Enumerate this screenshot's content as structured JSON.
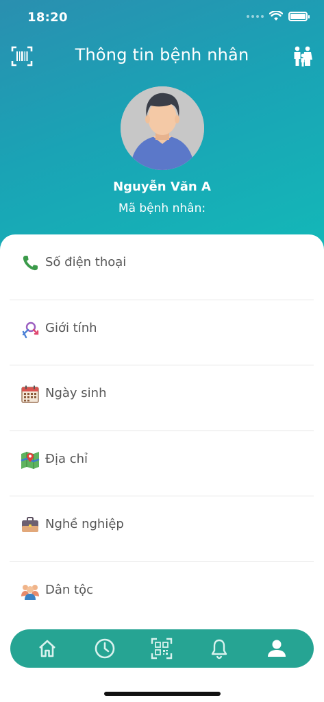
{
  "status_bar": {
    "time": "18:20"
  },
  "header": {
    "title": "Thông tin bệnh nhân",
    "left_icon": "barcode-scan-icon",
    "right_icon": "family-icon"
  },
  "patient": {
    "name": "Nguyễn Văn A",
    "code_label": "Mã bệnh nhân:"
  },
  "info_rows": [
    {
      "label": "Số điện thoại",
      "icon": "phone-icon"
    },
    {
      "label": "Giới tính",
      "icon": "gender-icon"
    },
    {
      "label": "Ngày sinh",
      "icon": "calendar-icon"
    },
    {
      "label": "Địa chỉ",
      "icon": "map-icon"
    },
    {
      "label": "Nghề nghiệp",
      "icon": "briefcase-icon"
    },
    {
      "label": "Dân tộc",
      "icon": "people-icon"
    }
  ],
  "bottom_nav": {
    "items": [
      "home-icon",
      "clock-icon",
      "qr-scan-icon",
      "bell-icon",
      "profile-icon"
    ],
    "active": "profile-icon"
  },
  "colors": {
    "header_gradient_start": "#2a8fb0",
    "header_gradient_end": "#13b9b8",
    "nav_bg": "#26a493"
  }
}
